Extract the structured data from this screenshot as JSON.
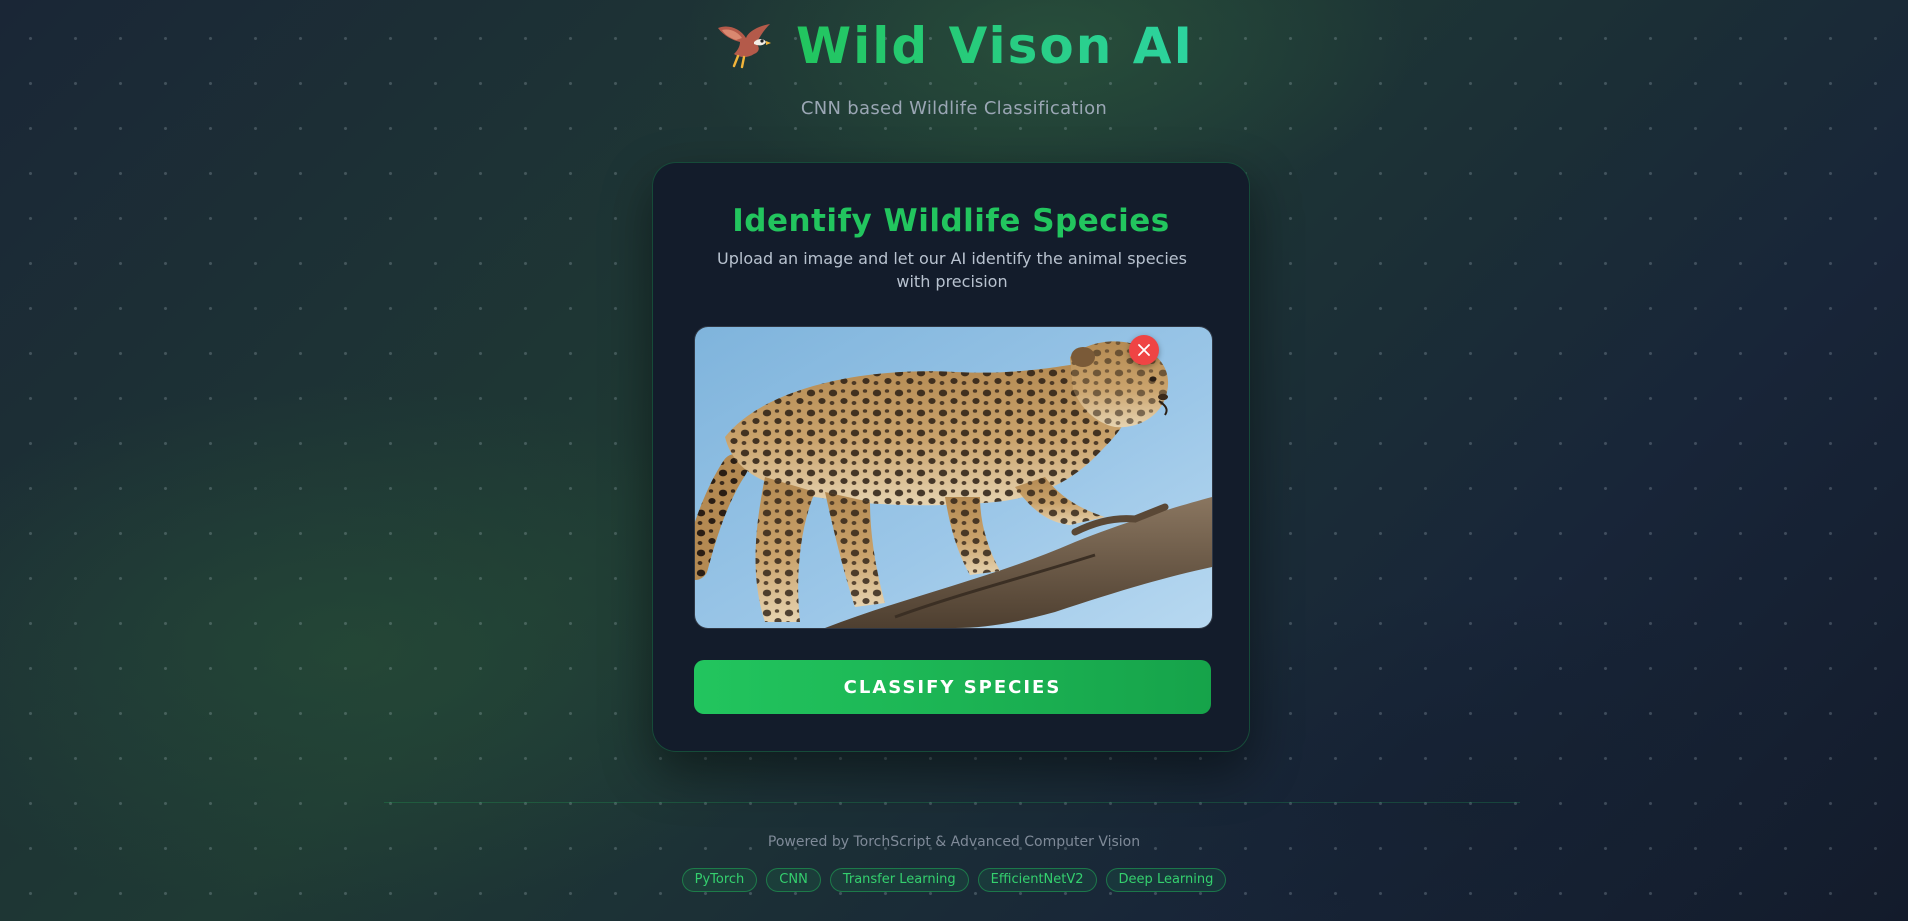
{
  "app": {
    "title": "Wild Vison AI",
    "subtitle": "CNN based Wildlife Classification",
    "logo_icon": "eagle-icon"
  },
  "card": {
    "title": "Identify Wildlife Species",
    "description": "Upload an image and let our AI identify the animal species with precision",
    "preview_image": "leopard-on-branch",
    "remove_icon": "close-icon",
    "classify_label": "CLASSIFY SPECIES"
  },
  "footer": {
    "powered_by": "Powered by TorchScript & Advanced Computer Vision",
    "tags": [
      "PyTorch",
      "CNN",
      "Transfer Learning",
      "EfficientNetV2",
      "Deep Learning"
    ]
  },
  "colors": {
    "accent": "#22c55e",
    "remove": "#ef4444",
    "card_bg": "#131c2b"
  }
}
